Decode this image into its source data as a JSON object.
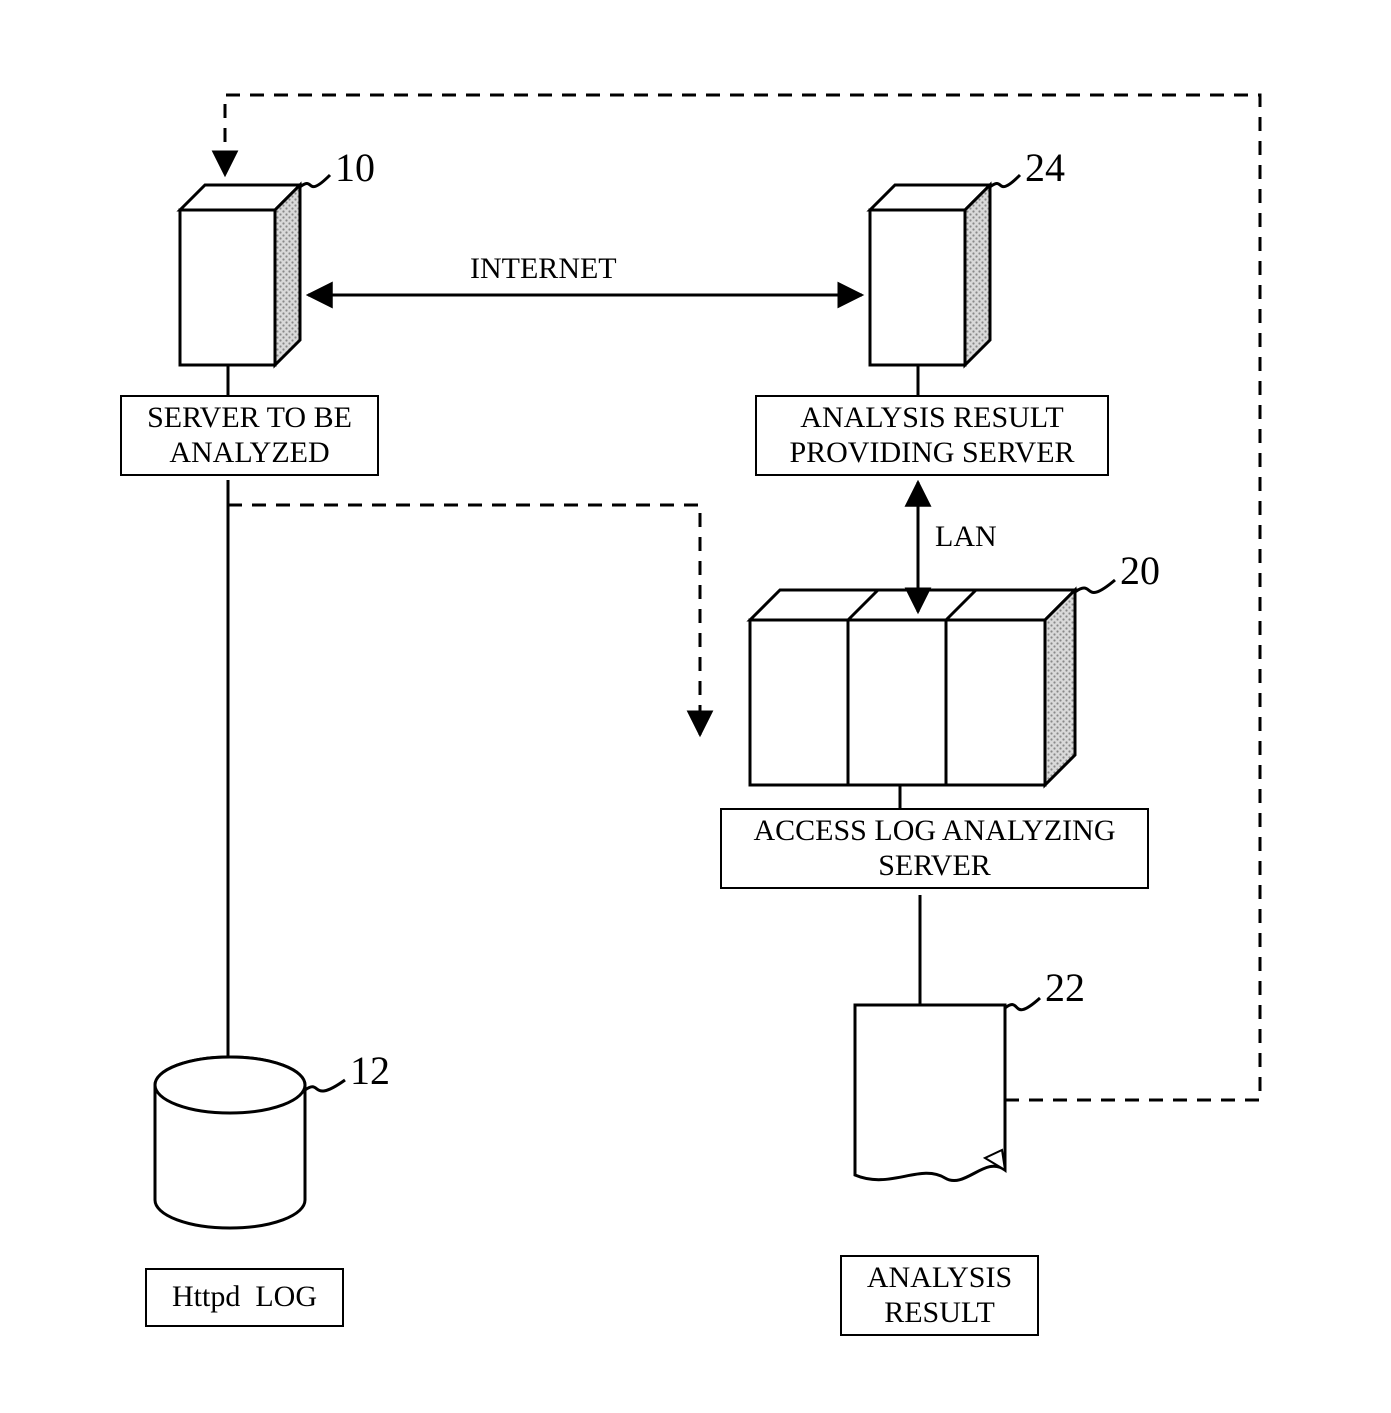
{
  "labels": {
    "server_to_be_analyzed": "SERVER TO BE\nANALYZED",
    "analysis_result_providing_server": "ANALYSIS RESULT\nPROVIDING SERVER",
    "access_log_analyzing_server": "ACCESS LOG ANALYZING\nSERVER",
    "httpd_log": "Httpd  LOG",
    "analysis_result_box": "ANALYSIS\nRESULT",
    "internet": "INTERNET",
    "lan": "LAN"
  },
  "refs": {
    "n10": "10",
    "n12": "12",
    "n20": "20",
    "n22": "22",
    "n24": "24"
  }
}
